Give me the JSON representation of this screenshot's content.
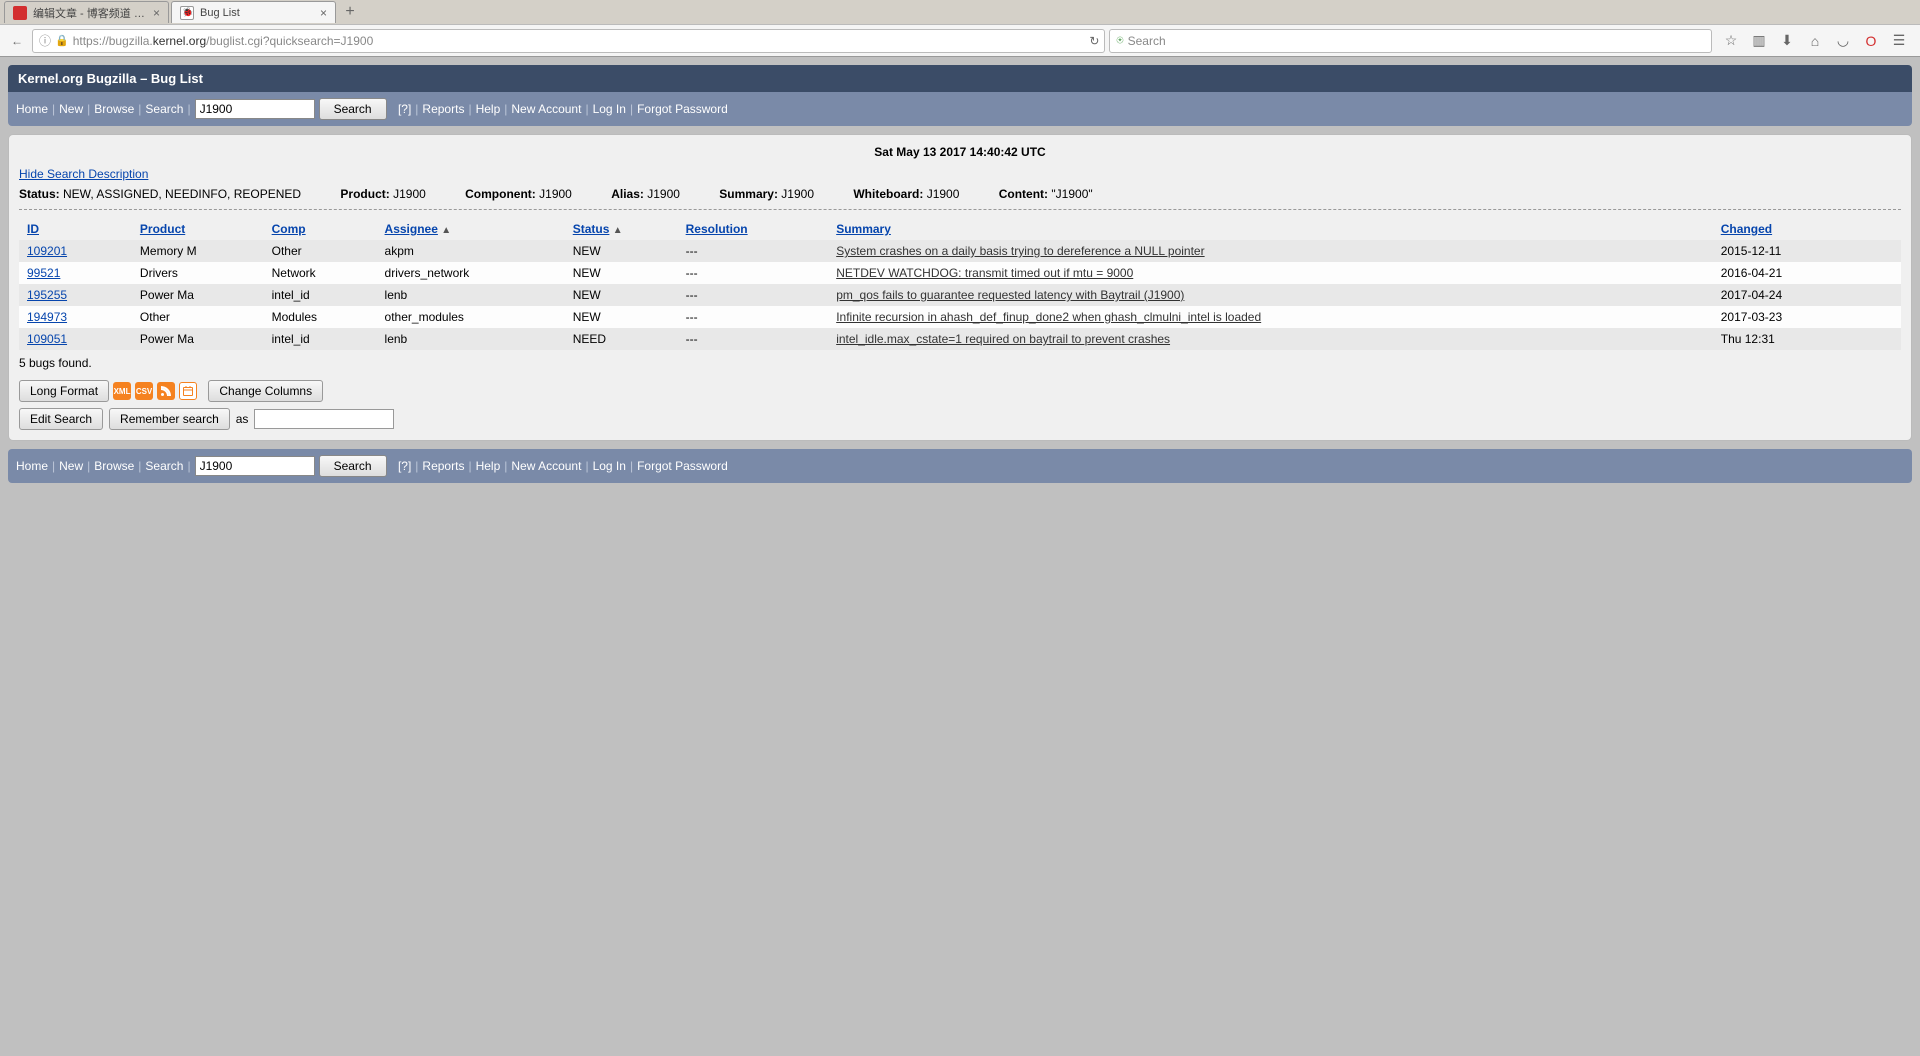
{
  "browser": {
    "tabs": [
      {
        "title": "编辑文章 - 博客频道 - C",
        "active": false
      },
      {
        "title": "Bug List",
        "active": true
      }
    ],
    "url_prefix": "https://bugzilla.",
    "url_domain": "kernel.org",
    "url_suffix": "/buglist.cgi?quicksearch=J1900",
    "search_placeholder": "Search"
  },
  "banner": "Kernel.org Bugzilla – Bug List",
  "nav": {
    "home": "Home",
    "new": "New",
    "browse": "Browse",
    "search": "Search",
    "quick_value": "J1900",
    "search_btn": "Search",
    "help_q": "[?]",
    "reports": "Reports",
    "help": "Help",
    "new_account": "New Account",
    "login": "Log In",
    "forgot": "Forgot Password"
  },
  "timestamp": "Sat May 13 2017 14:40:42 UTC",
  "hide_desc": "Hide Search Description",
  "criteria": {
    "status_label": "Status:",
    "status_value": "NEW, ASSIGNED, NEEDINFO, REOPENED",
    "product_label": "Product:",
    "product_value": "J1900",
    "component_label": "Component:",
    "component_value": "J1900",
    "alias_label": "Alias:",
    "alias_value": "J1900",
    "summary_label": "Summary:",
    "summary_value": "J1900",
    "whiteboard_label": "Whiteboard:",
    "whiteboard_value": "J1900",
    "content_label": "Content:",
    "content_value": "\"J1900\""
  },
  "columns": {
    "id": "ID",
    "product": "Product",
    "comp": "Comp",
    "assignee": "Assignee",
    "status": "Status",
    "resolution": "Resolution",
    "summary": "Summary",
    "changed": "Changed"
  },
  "sort_indicator": "▲",
  "bugs": [
    {
      "id": "109201",
      "product": "Memory M",
      "comp": "Other",
      "assignee": "akpm",
      "status": "NEW",
      "resolution": "---",
      "summary": "System crashes on a daily basis trying to dereference a NULL pointer",
      "changed": "2015-12-11"
    },
    {
      "id": "99521",
      "product": "Drivers",
      "comp": "Network",
      "assignee": "drivers_network",
      "status": "NEW",
      "resolution": "---",
      "summary": "NETDEV WATCHDOG: transmit timed out if mtu = 9000",
      "changed": "2016-04-21"
    },
    {
      "id": "195255",
      "product": "Power Ma",
      "comp": "intel_id",
      "assignee": "lenb",
      "status": "NEW",
      "resolution": "---",
      "summary": "pm_qos fails to guarantee requested latency with Baytrail (J1900)",
      "changed": "2017-04-24"
    },
    {
      "id": "194973",
      "product": "Other",
      "comp": "Modules",
      "assignee": "other_modules",
      "status": "NEW",
      "resolution": "---",
      "summary": "Infinite recursion in ahash_def_finup_done2 when ghash_clmulni_intel is loaded",
      "changed": "2017-03-23"
    },
    {
      "id": "109051",
      "product": "Power Ma",
      "comp": "intel_id",
      "assignee": "lenb",
      "status": "NEED",
      "resolution": "---",
      "summary": "intel_idle.max_cstate=1 required on baytrail to prevent crashes",
      "changed": "Thu 12:31"
    }
  ],
  "found_text": "5 bugs found.",
  "buttons": {
    "long_format": "Long Format",
    "change_columns": "Change Columns",
    "edit_search": "Edit Search",
    "remember_search": "Remember search",
    "as_label": "as"
  },
  "icon_labels": {
    "xml": "XML",
    "csv": "CSV",
    "rss": "",
    "cal": ""
  }
}
